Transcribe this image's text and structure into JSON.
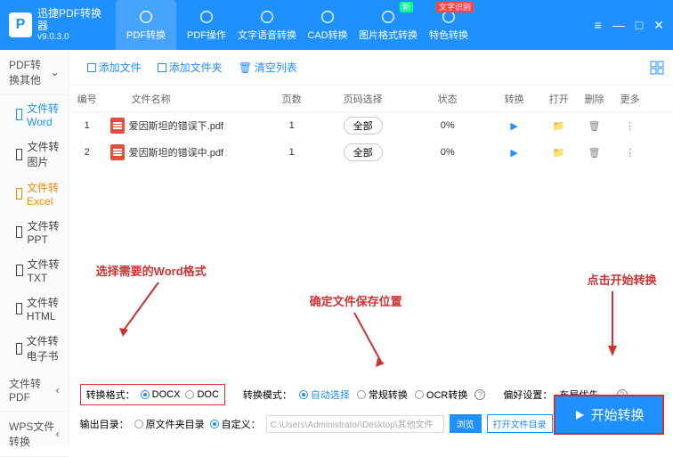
{
  "app": {
    "title": "迅捷PDF转换器",
    "version": "v9.0.3.0"
  },
  "topTabs": [
    {
      "label": "PDF转换",
      "icon": "swap"
    },
    {
      "label": "PDF操作",
      "icon": "target"
    },
    {
      "label": "文字语音转换",
      "icon": "text"
    },
    {
      "label": "CAD转换",
      "icon": "download"
    },
    {
      "label": "图片格式转换",
      "icon": "image",
      "badge": "新"
    },
    {
      "label": "特色转换",
      "icon": "grid",
      "badge": "文字识别"
    }
  ],
  "sidebar": {
    "cat1": "PDF转换其他",
    "items": [
      "文件转Word",
      "文件转图片",
      "文件转Excel",
      "文件转PPT",
      "文件转TXT",
      "文件转HTML",
      "文件转电子书"
    ],
    "cat2": "文件转PDF",
    "cat3": "WPS文件转换"
  },
  "toolbar": {
    "addFile": "添加文件",
    "addFolder": "添加文件夹",
    "clear": "清空列表"
  },
  "columns": {
    "idx": "编号",
    "name": "文件名称",
    "pages": "页数",
    "pageSel": "页码选择",
    "status": "状态",
    "convert": "转换",
    "open": "打开",
    "del": "删除",
    "more": "更多"
  },
  "rows": [
    {
      "idx": "1",
      "name": "爱因斯坦的错误下.pdf",
      "pages": "1",
      "pageSel": "全部",
      "status": "0%"
    },
    {
      "idx": "2",
      "name": "爱因斯坦的错误中.pdf",
      "pages": "1",
      "pageSel": "全部",
      "status": "0%"
    }
  ],
  "format": {
    "label": "转换格式：",
    "docx": "DOCX",
    "doc": "DOC"
  },
  "mode": {
    "label": "转换模式：",
    "auto": "自动选择",
    "normal": "常规转换",
    "ocr": "OCR转换"
  },
  "layout": {
    "label": "偏好设置：",
    "value": "布局优先"
  },
  "output": {
    "label": "输出目录：",
    "orig": "原文件夹目录",
    "custom": "自定义：",
    "path": "C:\\Users\\Administrator\\Desktop\\其他文件",
    "browse": "浏览",
    "open": "打开文件目录"
  },
  "start": "开始转换",
  "anno": {
    "a1": "选择需要的Word格式",
    "a2": "确定文件保存位置",
    "a3": "点击开始转换"
  }
}
